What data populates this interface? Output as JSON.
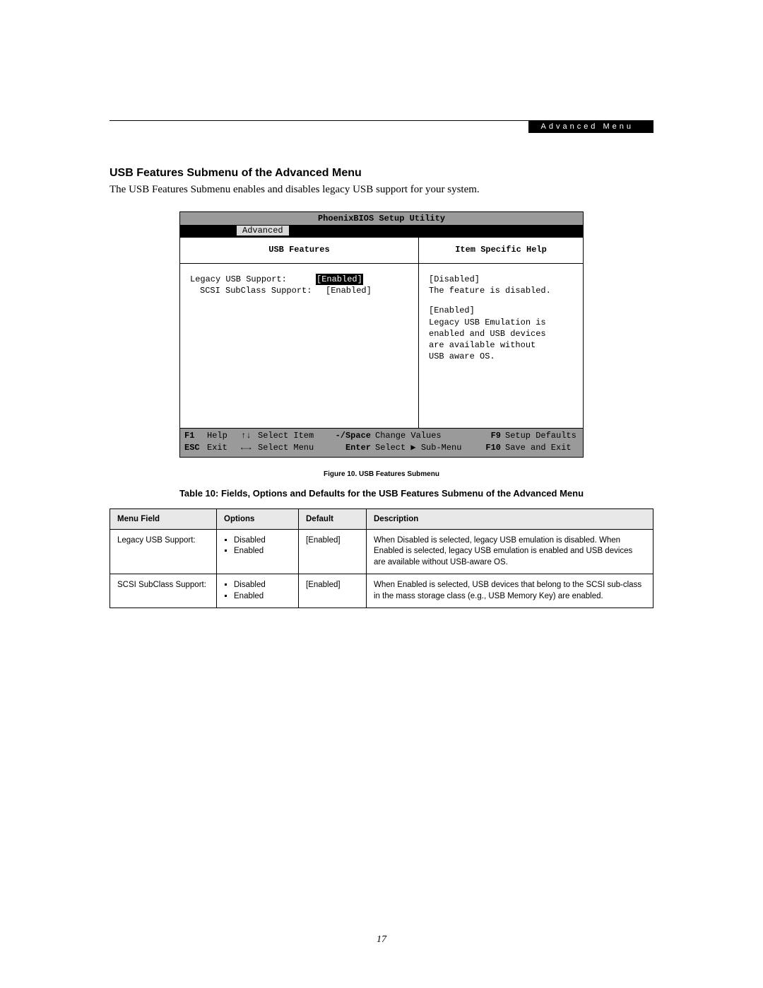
{
  "header": {
    "section_label": "Advanced Menu"
  },
  "section": {
    "title": "USB Features Submenu of the Advanced Menu",
    "intro": "The USB Features Submenu enables and disables legacy USB support for your system."
  },
  "bios": {
    "utility_title": "PhoenixBIOS Setup Utility",
    "tab_active": "Advanced",
    "left_panel_title": "USB Features",
    "right_panel_title": "Item Specific Help",
    "settings": [
      {
        "label": "Legacy USB Support:",
        "value": "[Enabled]",
        "selected": true
      },
      {
        "label": "SCSI SubClass Support:",
        "value": "[Enabled]",
        "selected": false
      }
    ],
    "help": {
      "disabled_title": "[Disabled]",
      "disabled_text": "The feature is disabled.",
      "enabled_title": "[Enabled]",
      "enabled_text": "Legacy USB Emulation is enabled and USB devices are available without USB aware OS."
    },
    "footer": {
      "r1": {
        "k1": "F1",
        "l1": "Help",
        "k2": "↑↓",
        "l2": "Select Item",
        "k3": "-/Space",
        "l3": "Change Values",
        "k4": "F9",
        "l4": "Setup Defaults"
      },
      "r2": {
        "k1": "ESC",
        "l1": "Exit",
        "k2": "←→",
        "l2": "Select Menu",
        "k3": "Enter",
        "l3": "Select ▶ Sub-Menu",
        "k4": "F10",
        "l4": "Save and Exit"
      }
    }
  },
  "figure_caption": "Figure 10.  USB Features Submenu",
  "table_title": "Table 10: Fields, Options and Defaults for the USB Features Submenu of the Advanced Menu",
  "table": {
    "headers": {
      "field": "Menu Field",
      "options": "Options",
      "default": "Default",
      "description": "Description"
    },
    "rows": [
      {
        "field": "Legacy USB Support:",
        "options": [
          "Disabled",
          "Enabled"
        ],
        "default": "[Enabled]",
        "description": "When Disabled is selected, legacy USB emulation is disabled. When Enabled is selected, legacy USB emulation is enabled and USB devices are available without USB-aware OS."
      },
      {
        "field": "SCSI SubClass Support:",
        "options": [
          "Disabled",
          "Enabled"
        ],
        "default": "[Enabled]",
        "description": "When Enabled is selected, USB devices that belong to the SCSI sub-class in the mass storage class (e.g., USB Memory Key) are enabled."
      }
    ]
  },
  "page_number": "17"
}
